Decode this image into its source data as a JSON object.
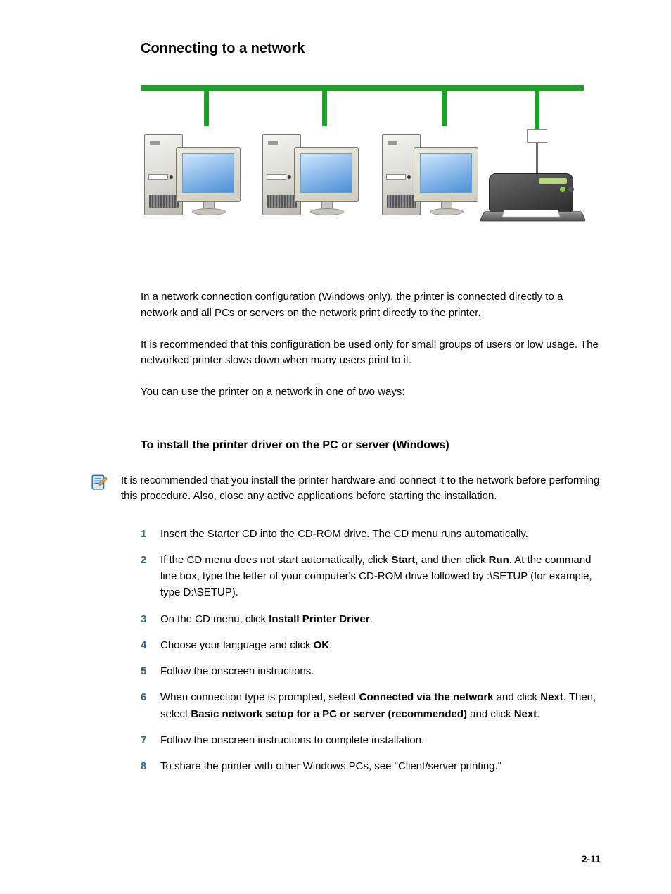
{
  "title": "Connecting to a network",
  "description_paragraphs": [
    "In a network connection configuration (Windows only), the printer is connected directly to a network and all PCs or servers on the network print directly to the printer.",
    "It is recommended that this configuration be used only for small groups of users or low usage. The networked printer slows down when many users print to it.",
    "You can use the printer on a network in one of two ways:"
  ],
  "subheading": "To install the printer driver on the PC or server (Windows)",
  "note": "It is recommended that you install the printer hardware and connect it to the network before performing this procedure. Also, close any active applications before starting the installation.",
  "steps": [
    {
      "text": "Insert the Starter CD into the CD-ROM drive. The CD menu runs automatically."
    },
    {
      "pre": "If the CD menu does not start automatically, click ",
      "b1": "Start",
      "mid1": ", and then click ",
      "b2": "Run",
      "post": ". At the command line box, type the letter of your computer's CD-ROM drive followed by :\\SETUP (for example, type D:\\SETUP)."
    },
    {
      "pre": "On the CD menu, click ",
      "b1": "Install Printer Driver",
      "post": "."
    },
    {
      "pre": "Choose your language and click ",
      "b1": "OK",
      "post": "."
    },
    {
      "text": "Follow the onscreen instructions."
    },
    {
      "pre": "When connection type is prompted, select ",
      "b1": "Connected via the network",
      "mid1": " and click ",
      "b2": "Next",
      "mid2": ". Then, select ",
      "b3": "Basic network setup for a PC or server (recommended)",
      "mid3": " and click ",
      "b4": "Next",
      "post": "."
    },
    {
      "text": "Follow the onscreen instructions to complete installation."
    },
    {
      "text": "To share the printer with other Windows PCs, see \"Client/server printing.\""
    }
  ],
  "page_number": "2-11"
}
